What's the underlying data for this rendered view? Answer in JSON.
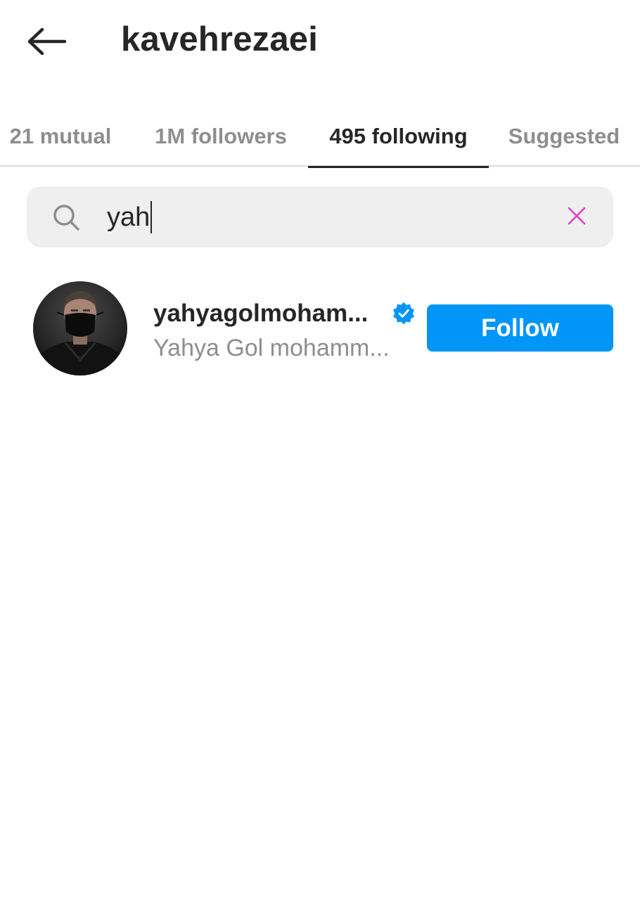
{
  "header": {
    "back_icon": "arrow-left-icon",
    "title": "kavehrezaei"
  },
  "tabs": [
    {
      "label": "21 mutual",
      "active": false
    },
    {
      "label": "1M followers",
      "active": false
    },
    {
      "label": "495 following",
      "active": true
    },
    {
      "label": "Suggested",
      "active": false
    }
  ],
  "search": {
    "icon": "search-icon",
    "value": "yah",
    "clear_icon": "close-icon",
    "clear_color": "#e040c8"
  },
  "results": [
    {
      "username": "yahyagolmoham...",
      "full_name": "Yahya Gol mohamm...",
      "verified": true,
      "verified_color": "#0095f6",
      "follow_label": "Follow",
      "follow_color": "#0095f6"
    }
  ]
}
